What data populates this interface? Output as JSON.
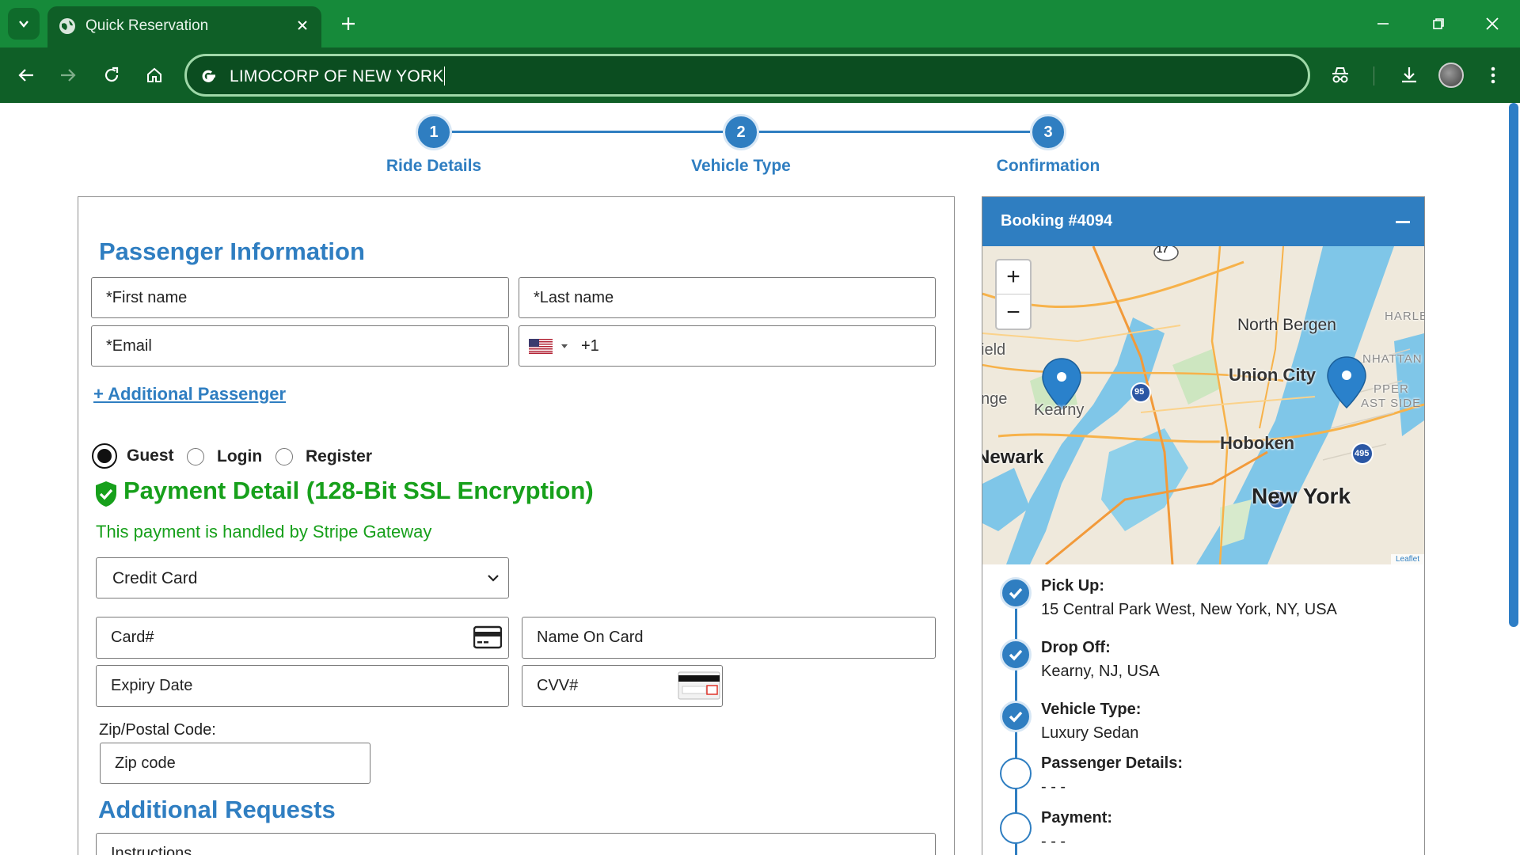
{
  "browser": {
    "tab_title": "Quick Reservation",
    "omnibox_text": "LIMOCORP OF NEW YORK"
  },
  "steps": [
    {
      "number": "1",
      "label": "Ride Details"
    },
    {
      "number": "2",
      "label": "Vehicle Type"
    },
    {
      "number": "3",
      "label": "Confirmation"
    }
  ],
  "passenger": {
    "title": "Passenger Information",
    "first_name_placeholder": "*First name",
    "last_name_placeholder": "*Last name",
    "email_placeholder": "*Email",
    "phone_prefix": "+1",
    "add_passenger_link": "+ Additional Passenger"
  },
  "account_options": {
    "guest": "Guest",
    "login": "Login",
    "register": "Register",
    "selected": "Guest"
  },
  "payment": {
    "title": "Payment Detail (128-Bit SSL Encryption)",
    "subtitle": "This payment is handled by Stripe Gateway",
    "method_selected": "Credit Card",
    "card_placeholder": "Card#",
    "name_placeholder": "Name On Card",
    "expiry_placeholder": "Expiry Date",
    "cvv_placeholder": "CVV#",
    "zip_label": "Zip/Postal Code:",
    "zip_placeholder": "Zip code"
  },
  "additional": {
    "title": "Additional Requests",
    "instructions_placeholder": "Instructions"
  },
  "booking": {
    "title": "Booking #4094",
    "map": {
      "labels": [
        "North Bergen",
        "Union City",
        "Hoboken",
        "New York",
        "Newark",
        "Kearny",
        "HARLE",
        "NHATTAN",
        "PPER",
        "AST SIDE",
        "ield",
        "nge"
      ],
      "shields": [
        "17",
        "95",
        "495",
        "78"
      ],
      "attribution": "Leaflet",
      "zoom_in": "+",
      "zoom_out": "−"
    },
    "timeline": [
      {
        "title": "Pick Up:",
        "value": "15 Central Park West, New York, NY, USA",
        "done": true
      },
      {
        "title": "Drop Off:",
        "value": "Kearny, NJ, USA",
        "done": true
      },
      {
        "title": "Vehicle Type:",
        "value": "Luxury Sedan",
        "done": true
      },
      {
        "title": "Passenger Details:",
        "value": "- - -",
        "done": false
      },
      {
        "title": "Payment:",
        "value": "- - -",
        "done": false
      }
    ]
  },
  "colors": {
    "accent": "#2f7ec1",
    "success": "#17a01b",
    "chrome": "#168a3a"
  }
}
